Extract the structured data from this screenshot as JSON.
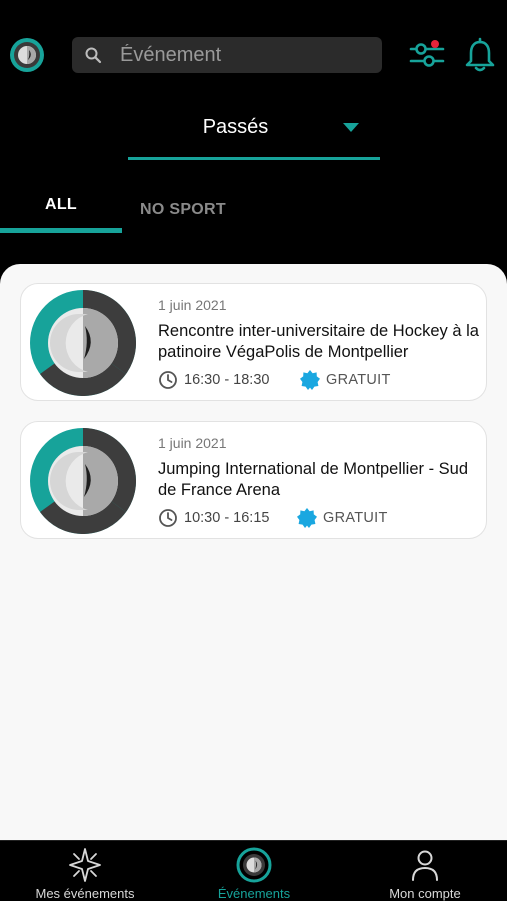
{
  "header": {
    "logo_icon": "app-logo-icon",
    "search": {
      "placeholder": "Événement",
      "value": "",
      "icon": "search-icon"
    },
    "filter_icon": "filter-sliders-icon",
    "notification_icon": "bell-icon",
    "accent_color": "#17a39a",
    "notification_dot_color": "#e5243b"
  },
  "period_selector": {
    "selected": "Passés",
    "icon": "caret-down-icon"
  },
  "tabs": [
    {
      "label": "ALL",
      "active": true
    },
    {
      "label": "NO SPORT",
      "active": false
    }
  ],
  "events": [
    {
      "date": "1 juin 2021",
      "title": "Rencontre inter-universitaire de Hockey à la patinoire VégaPolis de Montpellier",
      "time": "16:30 - 18:30",
      "price": "GRATUIT"
    },
    {
      "date": "1 juin 2021",
      "title": "Jumping International de Montpellier - Sud de France Arena",
      "time": "10:30 - 16:15",
      "price": "GRATUIT"
    }
  ],
  "bottom_nav": [
    {
      "label": "Mes événements",
      "icon": "sparkle-icon",
      "active": false
    },
    {
      "label": "Événements",
      "icon": "app-logo-icon",
      "active": true
    },
    {
      "label": "Mon compte",
      "icon": "user-icon",
      "active": false
    }
  ]
}
